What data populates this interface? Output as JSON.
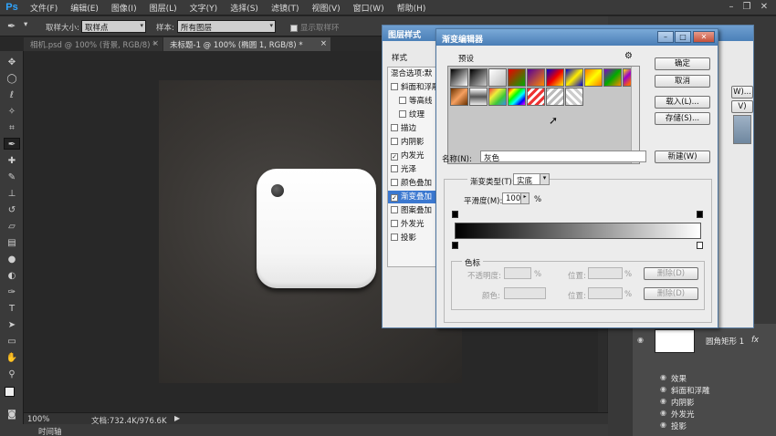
{
  "app": {
    "logo": "Ps"
  },
  "menu": [
    "文件(F)",
    "编辑(E)",
    "图像(I)",
    "图层(L)",
    "文字(Y)",
    "选择(S)",
    "滤镜(T)",
    "视图(V)",
    "窗口(W)",
    "帮助(H)"
  ],
  "options_bar": {
    "sample_size_label": "取样大小:",
    "sample_size_value": "取样点",
    "sample_label": "样本:",
    "sample_value": "所有图层",
    "show_ring_label": "显示取样环"
  },
  "tabs": [
    {
      "label": "相机.psd @ 100% (背景, RGB/8) *",
      "active": false
    },
    {
      "label": "未标题-1 @ 100% (椭圆 1, RGB/8) *",
      "active": true
    }
  ],
  "tools": [
    "move-icon",
    "marquee-icon",
    "lasso-icon",
    "magic-wand-icon",
    "crop-icon",
    "eyedropper-icon",
    "healing-icon",
    "brush-icon",
    "stamp-icon",
    "history-brush-icon",
    "eraser-icon",
    "gradient-icon",
    "blur-icon",
    "dodge-icon",
    "pen-icon",
    "type-icon",
    "path-select-icon",
    "shape-icon",
    "hand-icon",
    "zoom-icon"
  ],
  "status": {
    "zoom": "100%",
    "doc_info": "文档:732.4K/976.6K"
  },
  "timeline": "时间轴",
  "layer_style": {
    "title": "图层样式",
    "styles_header": "样式",
    "blend_header": "混合选项:默",
    "items": [
      {
        "label": "斜面和浮雕",
        "checked": false,
        "indent": false,
        "selected": false
      },
      {
        "label": "等高线",
        "checked": false,
        "indent": true,
        "selected": false
      },
      {
        "label": "纹理",
        "checked": false,
        "indent": true,
        "selected": false
      },
      {
        "label": "描边",
        "checked": false,
        "indent": false,
        "selected": false
      },
      {
        "label": "内阴影",
        "checked": false,
        "indent": false,
        "selected": false
      },
      {
        "label": "内发光",
        "checked": true,
        "indent": false,
        "selected": false
      },
      {
        "label": "光泽",
        "checked": false,
        "indent": false,
        "selected": false
      },
      {
        "label": "颜色叠加",
        "checked": false,
        "indent": false,
        "selected": false
      },
      {
        "label": "渐变叠加",
        "checked": true,
        "indent": false,
        "selected": true
      },
      {
        "label": "图案叠加",
        "checked": false,
        "indent": false,
        "selected": false
      },
      {
        "label": "外发光",
        "checked": false,
        "indent": false,
        "selected": false
      },
      {
        "label": "投影",
        "checked": false,
        "indent": false,
        "selected": false
      }
    ],
    "side_buttons": [
      "W)...",
      "V)"
    ]
  },
  "gradient_editor": {
    "title": "渐变编辑器",
    "presets_label": "预设",
    "gear_icon": "gear-icon",
    "ok": "确定",
    "cancel": "取消",
    "load": "载入(L)...",
    "save": "存储(S)...",
    "name_label": "名称(N):",
    "name_value": "灰色",
    "new_button": "新建(W)",
    "type_label": "渐变类型(T):",
    "type_value": "实底",
    "smooth_label": "平滑度(M):",
    "smooth_value": "100",
    "smooth_unit": "%",
    "stops_label": "色标",
    "opacity_label": "不透明度:",
    "opacity_unit": "%",
    "location_label": "位置:",
    "location_unit": "%",
    "delete_label": "删除(D)",
    "color_label": "颜色:",
    "gradient_start": "#000000",
    "gradient_end": "#ffffff",
    "presets_row1": [
      "#000-#fff",
      "#000-transparent",
      "#fff-transparent",
      "red-green",
      "violet-orange",
      "blue-red-yellow",
      "blue-yellow-blue",
      "orange-yellow-orange",
      "violet-green-orange",
      "yellow-violet-orange-blue"
    ],
    "presets_row2": [
      "copper",
      "chrome",
      "transparent-rainbow",
      "spectrum",
      "transparent-stripes",
      "checker",
      "checker2"
    ]
  },
  "layers": {
    "layer_name": "圆角矩形 1",
    "fx": "fx",
    "effects_label": "效果",
    "effects": [
      "斜面和浮雕",
      "内阴影",
      "外发光",
      "投影"
    ]
  }
}
